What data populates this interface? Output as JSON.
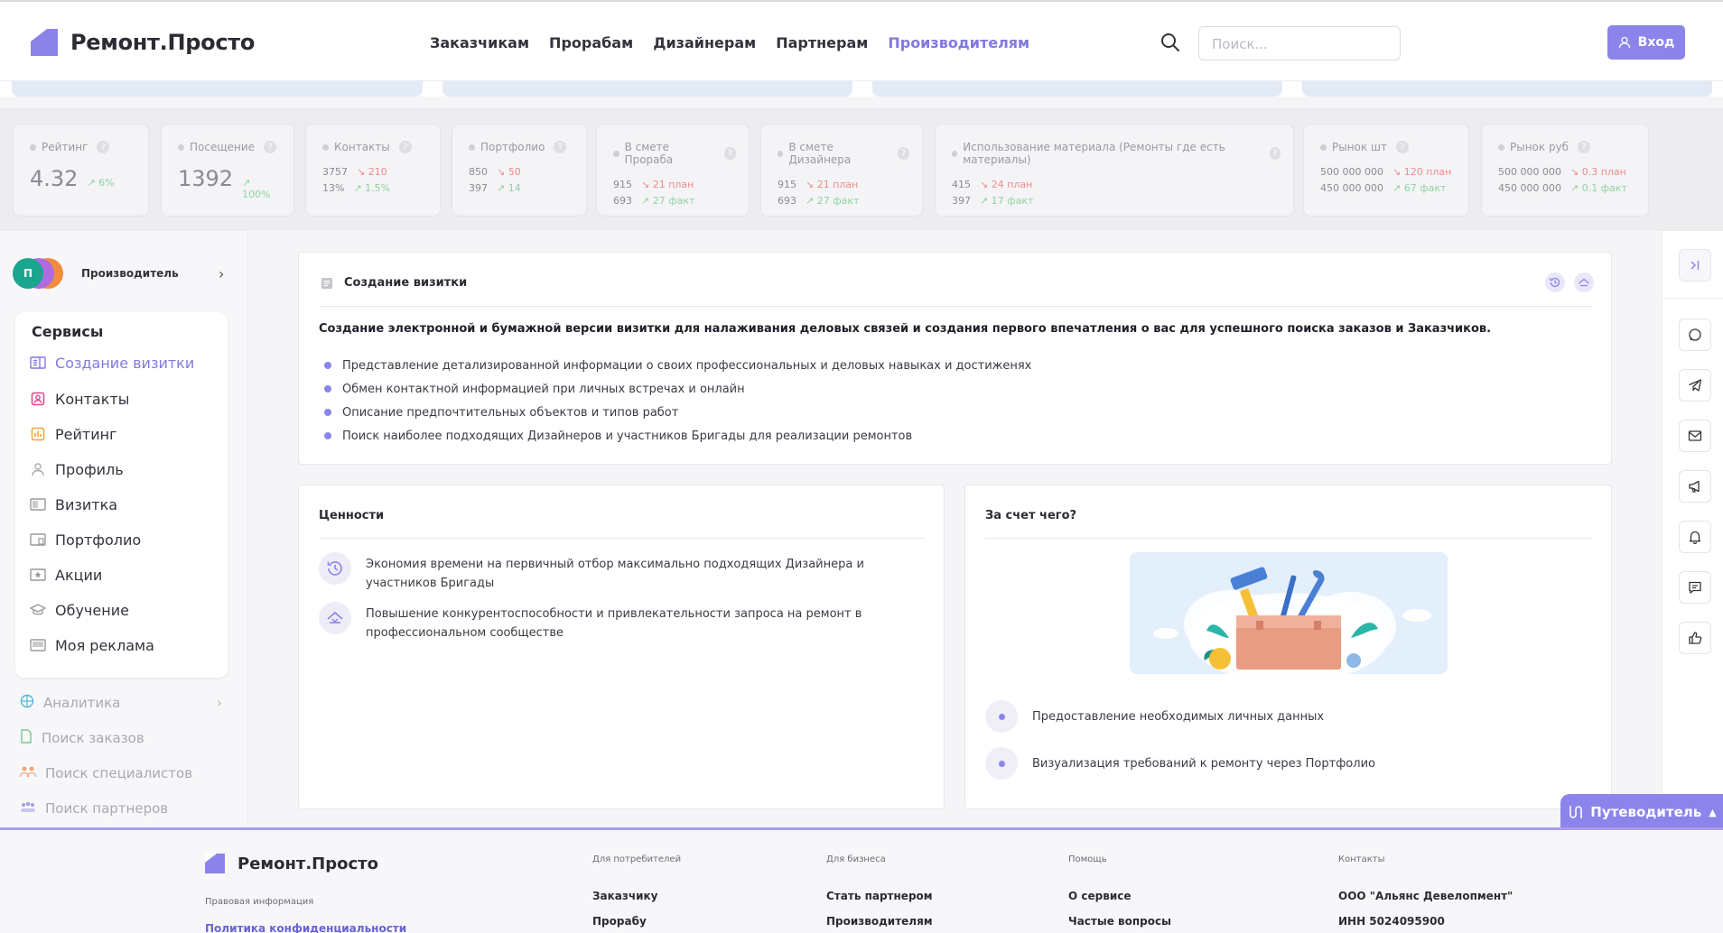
{
  "header": {
    "logo": "Ремонт.Просто",
    "nav": [
      "Заказчикам",
      "Прорабам",
      "Дизайнерам",
      "Партнерам",
      "Производителям"
    ],
    "active_nav": "Производителям",
    "search_placeholder": "Поиск...",
    "login": "Вход"
  },
  "stats": [
    {
      "title": "Рейтинг",
      "value": "4.32",
      "pct": "6%"
    },
    {
      "title": "Посещение",
      "value": "1392",
      "pct": "100%"
    },
    {
      "title": "Контакты",
      "r1a": "3757",
      "r1b": "210",
      "r2a": "13%",
      "r2b": "1.5%"
    },
    {
      "title": "Портфолио",
      "r1a": "850",
      "r1b": "50",
      "r2a": "397",
      "r2b": "14"
    },
    {
      "title": "В смете Прораба",
      "r1a": "915",
      "r1b": "21 план",
      "r2a": "693",
      "r2b": "27 факт"
    },
    {
      "title": "В смете Дизайнера",
      "r1a": "915",
      "r1b": "21 план",
      "r2a": "693",
      "r2b": "27 факт"
    },
    {
      "title": "Использование материала (Ремонты где есть материалы)",
      "r1a": "415",
      "r1b": "24 план",
      "r2a": "397",
      "r2b": "17 факт"
    },
    {
      "title": "Рынок шт",
      "r1a": "500 000 000",
      "r1b": "120 план",
      "r2a": "450 000 000",
      "r2b": "67 факт"
    },
    {
      "title": "Рынок руб",
      "r1a": "500 000 000",
      "r1b": "0.3 план",
      "r2a": "450 000 000",
      "r2b": "0.1 факт"
    }
  ],
  "sidebar": {
    "avatar_letter": "П",
    "role": "Производитель",
    "services_title": "Сервисы",
    "services": [
      "Создание визитки",
      "Контакты",
      "Рейтинг",
      "Профиль",
      "Визитка",
      "Портфолио",
      "Акции",
      "Обучение",
      "Моя реклама"
    ],
    "extra": [
      "Аналитика",
      "Поиск заказов",
      "Поиск специалистов",
      "Поиск партнеров"
    ]
  },
  "main": {
    "card_title": "Создание визитки",
    "lead": "Создание электронной и бумажной версии визитки для налаживания деловых связей и создания первого впечатления о вас для успешного поиска заказов и Заказчиков.",
    "bullets": [
      "Представление детализированной информации о своих профессиональных и деловых навыках и достиженях",
      "Обмен контактной информацией при личных встречах и онлайн",
      "Описание предпочтительных объектов и типов работ",
      "Поиск наиболее подходящих Дизайнеров и участников Бригады для реализации ремонтов"
    ],
    "values_title": "Ценности",
    "values": [
      "Экономия времени на первичный отбор максимально подходящих Дизайнера и участников Бригады",
      "Повышение конкурентоспособности и привлекательности запроса на ремонт в профессиональном сообществе"
    ],
    "how_title": "За счет чего?",
    "how": [
      "Предоставление необходимых личных данных",
      "Визуализация требований к ремонту через Портфолио"
    ]
  },
  "guide": "Путеводитель",
  "footer": {
    "logo": "Ремонт.Просто",
    "legal": "Правовая информация",
    "privacy": "Политика конфиденциальности",
    "col1_title": "Для потребителей",
    "col1": [
      "Заказчику",
      "Прорабу"
    ],
    "col2_title": "Для бизнеса",
    "col2": [
      "Стать партнером",
      "Производителям"
    ],
    "col3_title": "Помощь",
    "col3": [
      "О сервисе",
      "Частые вопросы"
    ],
    "col4_title": "Контакты",
    "col4": [
      "ООО \"Альянс Девелопмент\"",
      "ИНН 5024095900"
    ]
  },
  "colors": {
    "accent": "#8c84ea",
    "up": "#8fd3a0",
    "down": "#ef8b8b"
  }
}
